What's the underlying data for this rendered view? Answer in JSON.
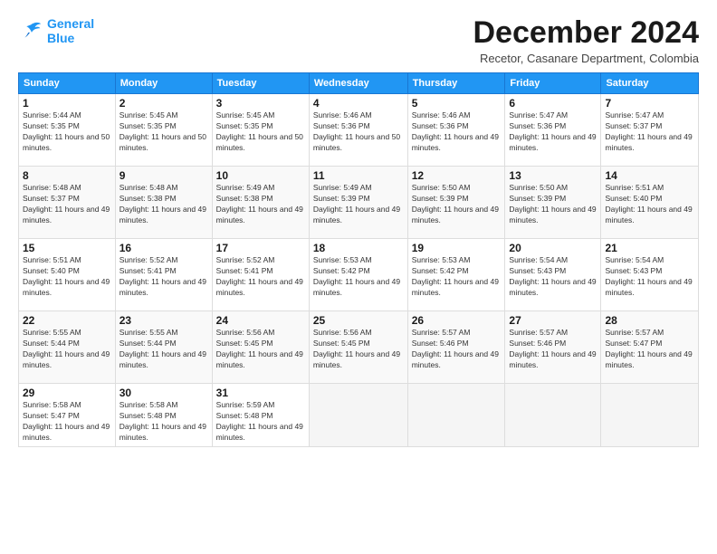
{
  "logo": {
    "line1": "General",
    "line2": "Blue"
  },
  "title": "December 2024",
  "location": "Recetor, Casanare Department, Colombia",
  "weekdays": [
    "Sunday",
    "Monday",
    "Tuesday",
    "Wednesday",
    "Thursday",
    "Friday",
    "Saturday"
  ],
  "weeks": [
    [
      {
        "day": "1",
        "sunrise": "5:44 AM",
        "sunset": "5:35 PM",
        "daylight": "11 hours and 50 minutes."
      },
      {
        "day": "2",
        "sunrise": "5:45 AM",
        "sunset": "5:35 PM",
        "daylight": "11 hours and 50 minutes."
      },
      {
        "day": "3",
        "sunrise": "5:45 AM",
        "sunset": "5:35 PM",
        "daylight": "11 hours and 50 minutes."
      },
      {
        "day": "4",
        "sunrise": "5:46 AM",
        "sunset": "5:36 PM",
        "daylight": "11 hours and 50 minutes."
      },
      {
        "day": "5",
        "sunrise": "5:46 AM",
        "sunset": "5:36 PM",
        "daylight": "11 hours and 49 minutes."
      },
      {
        "day": "6",
        "sunrise": "5:47 AM",
        "sunset": "5:36 PM",
        "daylight": "11 hours and 49 minutes."
      },
      {
        "day": "7",
        "sunrise": "5:47 AM",
        "sunset": "5:37 PM",
        "daylight": "11 hours and 49 minutes."
      }
    ],
    [
      {
        "day": "8",
        "sunrise": "5:48 AM",
        "sunset": "5:37 PM",
        "daylight": "11 hours and 49 minutes."
      },
      {
        "day": "9",
        "sunrise": "5:48 AM",
        "sunset": "5:38 PM",
        "daylight": "11 hours and 49 minutes."
      },
      {
        "day": "10",
        "sunrise": "5:49 AM",
        "sunset": "5:38 PM",
        "daylight": "11 hours and 49 minutes."
      },
      {
        "day": "11",
        "sunrise": "5:49 AM",
        "sunset": "5:39 PM",
        "daylight": "11 hours and 49 minutes."
      },
      {
        "day": "12",
        "sunrise": "5:50 AM",
        "sunset": "5:39 PM",
        "daylight": "11 hours and 49 minutes."
      },
      {
        "day": "13",
        "sunrise": "5:50 AM",
        "sunset": "5:39 PM",
        "daylight": "11 hours and 49 minutes."
      },
      {
        "day": "14",
        "sunrise": "5:51 AM",
        "sunset": "5:40 PM",
        "daylight": "11 hours and 49 minutes."
      }
    ],
    [
      {
        "day": "15",
        "sunrise": "5:51 AM",
        "sunset": "5:40 PM",
        "daylight": "11 hours and 49 minutes."
      },
      {
        "day": "16",
        "sunrise": "5:52 AM",
        "sunset": "5:41 PM",
        "daylight": "11 hours and 49 minutes."
      },
      {
        "day": "17",
        "sunrise": "5:52 AM",
        "sunset": "5:41 PM",
        "daylight": "11 hours and 49 minutes."
      },
      {
        "day": "18",
        "sunrise": "5:53 AM",
        "sunset": "5:42 PM",
        "daylight": "11 hours and 49 minutes."
      },
      {
        "day": "19",
        "sunrise": "5:53 AM",
        "sunset": "5:42 PM",
        "daylight": "11 hours and 49 minutes."
      },
      {
        "day": "20",
        "sunrise": "5:54 AM",
        "sunset": "5:43 PM",
        "daylight": "11 hours and 49 minutes."
      },
      {
        "day": "21",
        "sunrise": "5:54 AM",
        "sunset": "5:43 PM",
        "daylight": "11 hours and 49 minutes."
      }
    ],
    [
      {
        "day": "22",
        "sunrise": "5:55 AM",
        "sunset": "5:44 PM",
        "daylight": "11 hours and 49 minutes."
      },
      {
        "day": "23",
        "sunrise": "5:55 AM",
        "sunset": "5:44 PM",
        "daylight": "11 hours and 49 minutes."
      },
      {
        "day": "24",
        "sunrise": "5:56 AM",
        "sunset": "5:45 PM",
        "daylight": "11 hours and 49 minutes."
      },
      {
        "day": "25",
        "sunrise": "5:56 AM",
        "sunset": "5:45 PM",
        "daylight": "11 hours and 49 minutes."
      },
      {
        "day": "26",
        "sunrise": "5:57 AM",
        "sunset": "5:46 PM",
        "daylight": "11 hours and 49 minutes."
      },
      {
        "day": "27",
        "sunrise": "5:57 AM",
        "sunset": "5:46 PM",
        "daylight": "11 hours and 49 minutes."
      },
      {
        "day": "28",
        "sunrise": "5:57 AM",
        "sunset": "5:47 PM",
        "daylight": "11 hours and 49 minutes."
      }
    ],
    [
      {
        "day": "29",
        "sunrise": "5:58 AM",
        "sunset": "5:47 PM",
        "daylight": "11 hours and 49 minutes."
      },
      {
        "day": "30",
        "sunrise": "5:58 AM",
        "sunset": "5:48 PM",
        "daylight": "11 hours and 49 minutes."
      },
      {
        "day": "31",
        "sunrise": "5:59 AM",
        "sunset": "5:48 PM",
        "daylight": "11 hours and 49 minutes."
      },
      null,
      null,
      null,
      null
    ]
  ]
}
